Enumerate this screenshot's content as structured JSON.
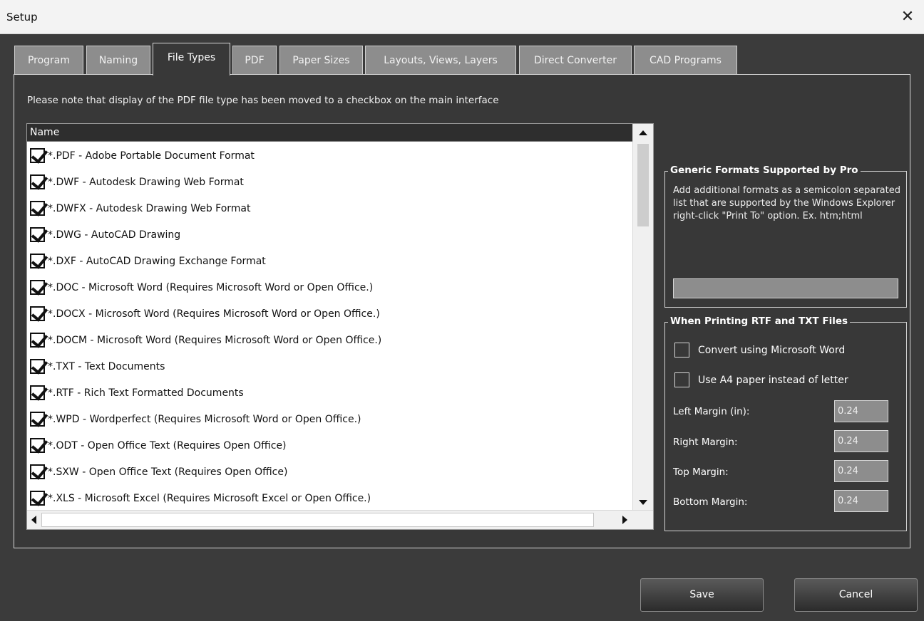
{
  "window": {
    "title": "Setup",
    "close_glyph": "✕"
  },
  "tabs": [
    {
      "label": "Program"
    },
    {
      "label": "Naming"
    },
    {
      "label": "File Types"
    },
    {
      "label": "PDF"
    },
    {
      "label": "Paper Sizes"
    },
    {
      "label": "Layouts, Views, Layers"
    },
    {
      "label": "Direct Converter"
    },
    {
      "label": "CAD Programs"
    }
  ],
  "active_tab": "File Types",
  "note": "Please note that display of the PDF file type has been moved to a checkbox on the main interface",
  "file_list": {
    "header": "Name",
    "items": [
      {
        "label": "*.PDF - Adobe Portable Document Format",
        "checked": true
      },
      {
        "label": "*.DWF - Autodesk Drawing Web Format",
        "checked": true
      },
      {
        "label": "*.DWFX - Autodesk Drawing Web Format",
        "checked": true
      },
      {
        "label": "*.DWG - AutoCAD Drawing",
        "checked": true
      },
      {
        "label": "*.DXF - AutoCAD Drawing Exchange Format",
        "checked": true
      },
      {
        "label": "*.DOC - Microsoft Word (Requires Microsoft Word or Open Office.)",
        "checked": true
      },
      {
        "label": "*.DOCX - Microsoft Word (Requires Microsoft Word or Open Office.)",
        "checked": true
      },
      {
        "label": "*.DOCM - Microsoft Word (Requires Microsoft Word or Open Office.)",
        "checked": true
      },
      {
        "label": "*.TXT - Text Documents",
        "checked": true
      },
      {
        "label": "*.RTF - Rich Text Formatted Documents",
        "checked": true
      },
      {
        "label": "*.WPD - Wordperfect (Requires Microsoft Word or Open Office.)",
        "checked": true
      },
      {
        "label": "*.ODT - Open Office Text (Requires Open Office)",
        "checked": true
      },
      {
        "label": "*.SXW - Open Office Text (Requires Open Office)",
        "checked": true
      },
      {
        "label": "*.XLS - Microsoft Excel (Requires Microsoft Excel or Open Office.)",
        "checked": true
      }
    ]
  },
  "generic_formats": {
    "legend": "Generic Formats Supported by Pro",
    "description": "Add additional formats as a semicolon separated list that are supported by the Windows Explorer right-click \"Print To\" option.  Ex. htm;html",
    "value": ""
  },
  "rtf_txt": {
    "legend": "When Printing RTF and TXT Files",
    "options": [
      {
        "label": "Convert using Microsoft Word",
        "checked": false
      },
      {
        "label": "Use A4 paper instead of letter",
        "checked": false
      }
    ],
    "margins": [
      {
        "label": "Left Margin (in):",
        "value": "0.24"
      },
      {
        "label": "Right Margin:",
        "value": "0.24"
      },
      {
        "label": "Top Margin:",
        "value": "0.24"
      },
      {
        "label": "Bottom Margin:",
        "value": "0.24"
      }
    ]
  },
  "buttons": {
    "save": "Save",
    "cancel": "Cancel"
  },
  "colors": {
    "background": "#3b3b3b",
    "panel": "#383838",
    "tab_inactive": "#8d8d8d",
    "field": "#8d8d8d"
  }
}
